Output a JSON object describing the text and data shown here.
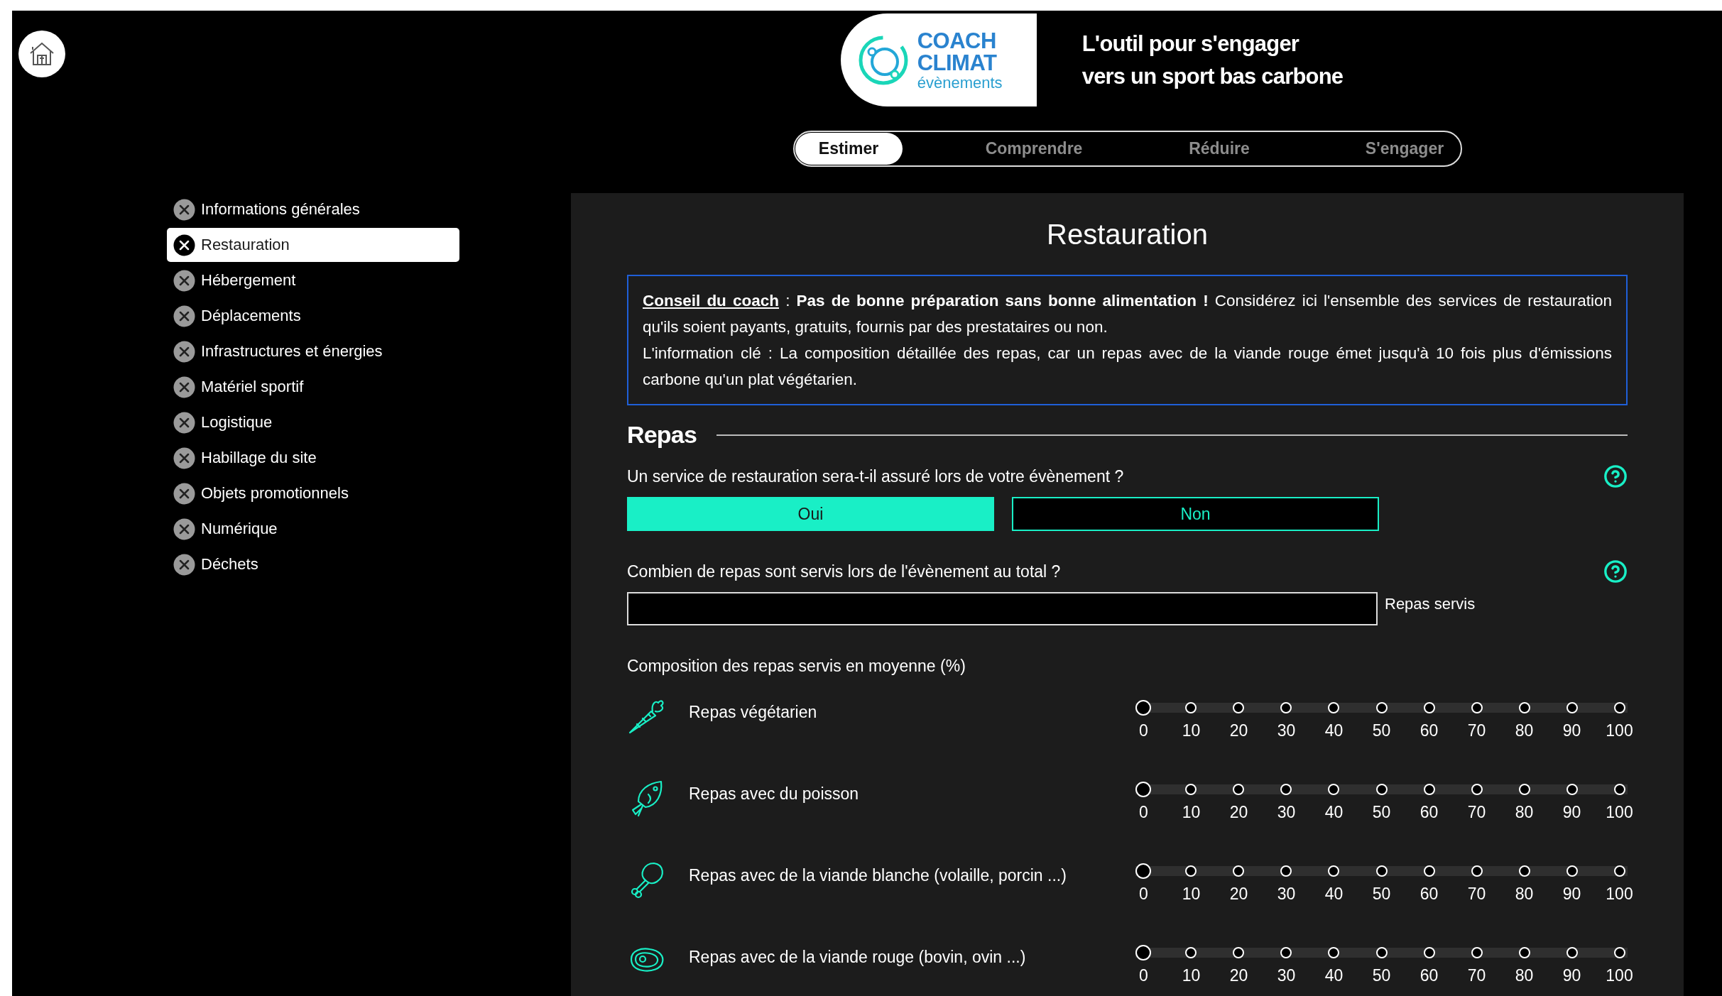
{
  "logo": {
    "name_line_1": "COACH",
    "name_line_2": "CLIMAT",
    "subtitle": "évènements"
  },
  "tagline": [
    "L'outil pour s'engager",
    "vers un sport bas carbone"
  ],
  "tabs": [
    {
      "label": "Estimer",
      "selected": true
    },
    {
      "label": "Comprendre",
      "selected": false
    },
    {
      "label": "Réduire",
      "selected": false
    },
    {
      "label": "S'engager",
      "selected": false
    }
  ],
  "sidebar": {
    "items": [
      {
        "label": "Informations générales",
        "selected": false
      },
      {
        "label": "Restauration",
        "selected": true
      },
      {
        "label": "Hébergement",
        "selected": false
      },
      {
        "label": "Déplacements",
        "selected": false
      },
      {
        "label": "Infrastructures et énergies",
        "selected": false
      },
      {
        "label": "Matériel sportif",
        "selected": false
      },
      {
        "label": "Logistique",
        "selected": false
      },
      {
        "label": "Habillage du site",
        "selected": false
      },
      {
        "label": "Objets promotionnels",
        "selected": false
      },
      {
        "label": "Numérique",
        "selected": false
      },
      {
        "label": "Déchets",
        "selected": false
      }
    ]
  },
  "panel": {
    "title": "Restauration",
    "coach_tip": {
      "link": "Conseil du coach",
      "text": " : **Pas de bonne préparation sans bonne alimentation !** Considérez ici l'ensemble des services de restauration qu'ils soient payants, gratuits, fournis par des prestataires ou non.",
      "key_info": "L'information clé : La composition détaillée des repas, car un repas avec de la viande rouge émet jusqu'à 10 fois plus d'émissions carbone qu'un plat végétarien."
    },
    "section_title": "Repas",
    "questions": [
      {
        "kind": "choice",
        "label": "Un service de restauration sera-t-il assuré lors de votre évènement ?",
        "options": [
          {
            "label": "Oui",
            "selected": true
          },
          {
            "label": "Non",
            "selected": false
          }
        ]
      },
      {
        "kind": "number",
        "label": "Combien de repas sont servis lors de l'évènement au total ?",
        "unit": "Repas servis"
      }
    ],
    "composition": {
      "title": "Composition des repas servis en moyenne (%)",
      "rows": [
        {
          "label": "Repas végétarien",
          "level": 0,
          "ticks": [
            "0",
            "10",
            "20",
            "30",
            "40",
            "50",
            "60",
            "70",
            "80",
            "90",
            "100"
          ]
        },
        {
          "label": "Repas avec du poisson",
          "level": 0,
          "ticks": [
            "0",
            "10",
            "20",
            "30",
            "40",
            "50",
            "60",
            "70",
            "80",
            "90",
            "100"
          ]
        },
        {
          "label": "Repas avec de la viande blanche (volaille, porcin ...)",
          "level": 0,
          "ticks": [
            "0",
            "10",
            "20",
            "30",
            "40",
            "50",
            "60",
            "70",
            "80",
            "90",
            "100"
          ]
        },
        {
          "label": "Repas avec de la viande rouge (bovin, ovin ...)",
          "level": 0,
          "ticks": [
            "0",
            "10",
            "20",
            "30",
            "40",
            "50",
            "60",
            "70",
            "80",
            "90",
            "100"
          ]
        }
      ]
    }
  }
}
